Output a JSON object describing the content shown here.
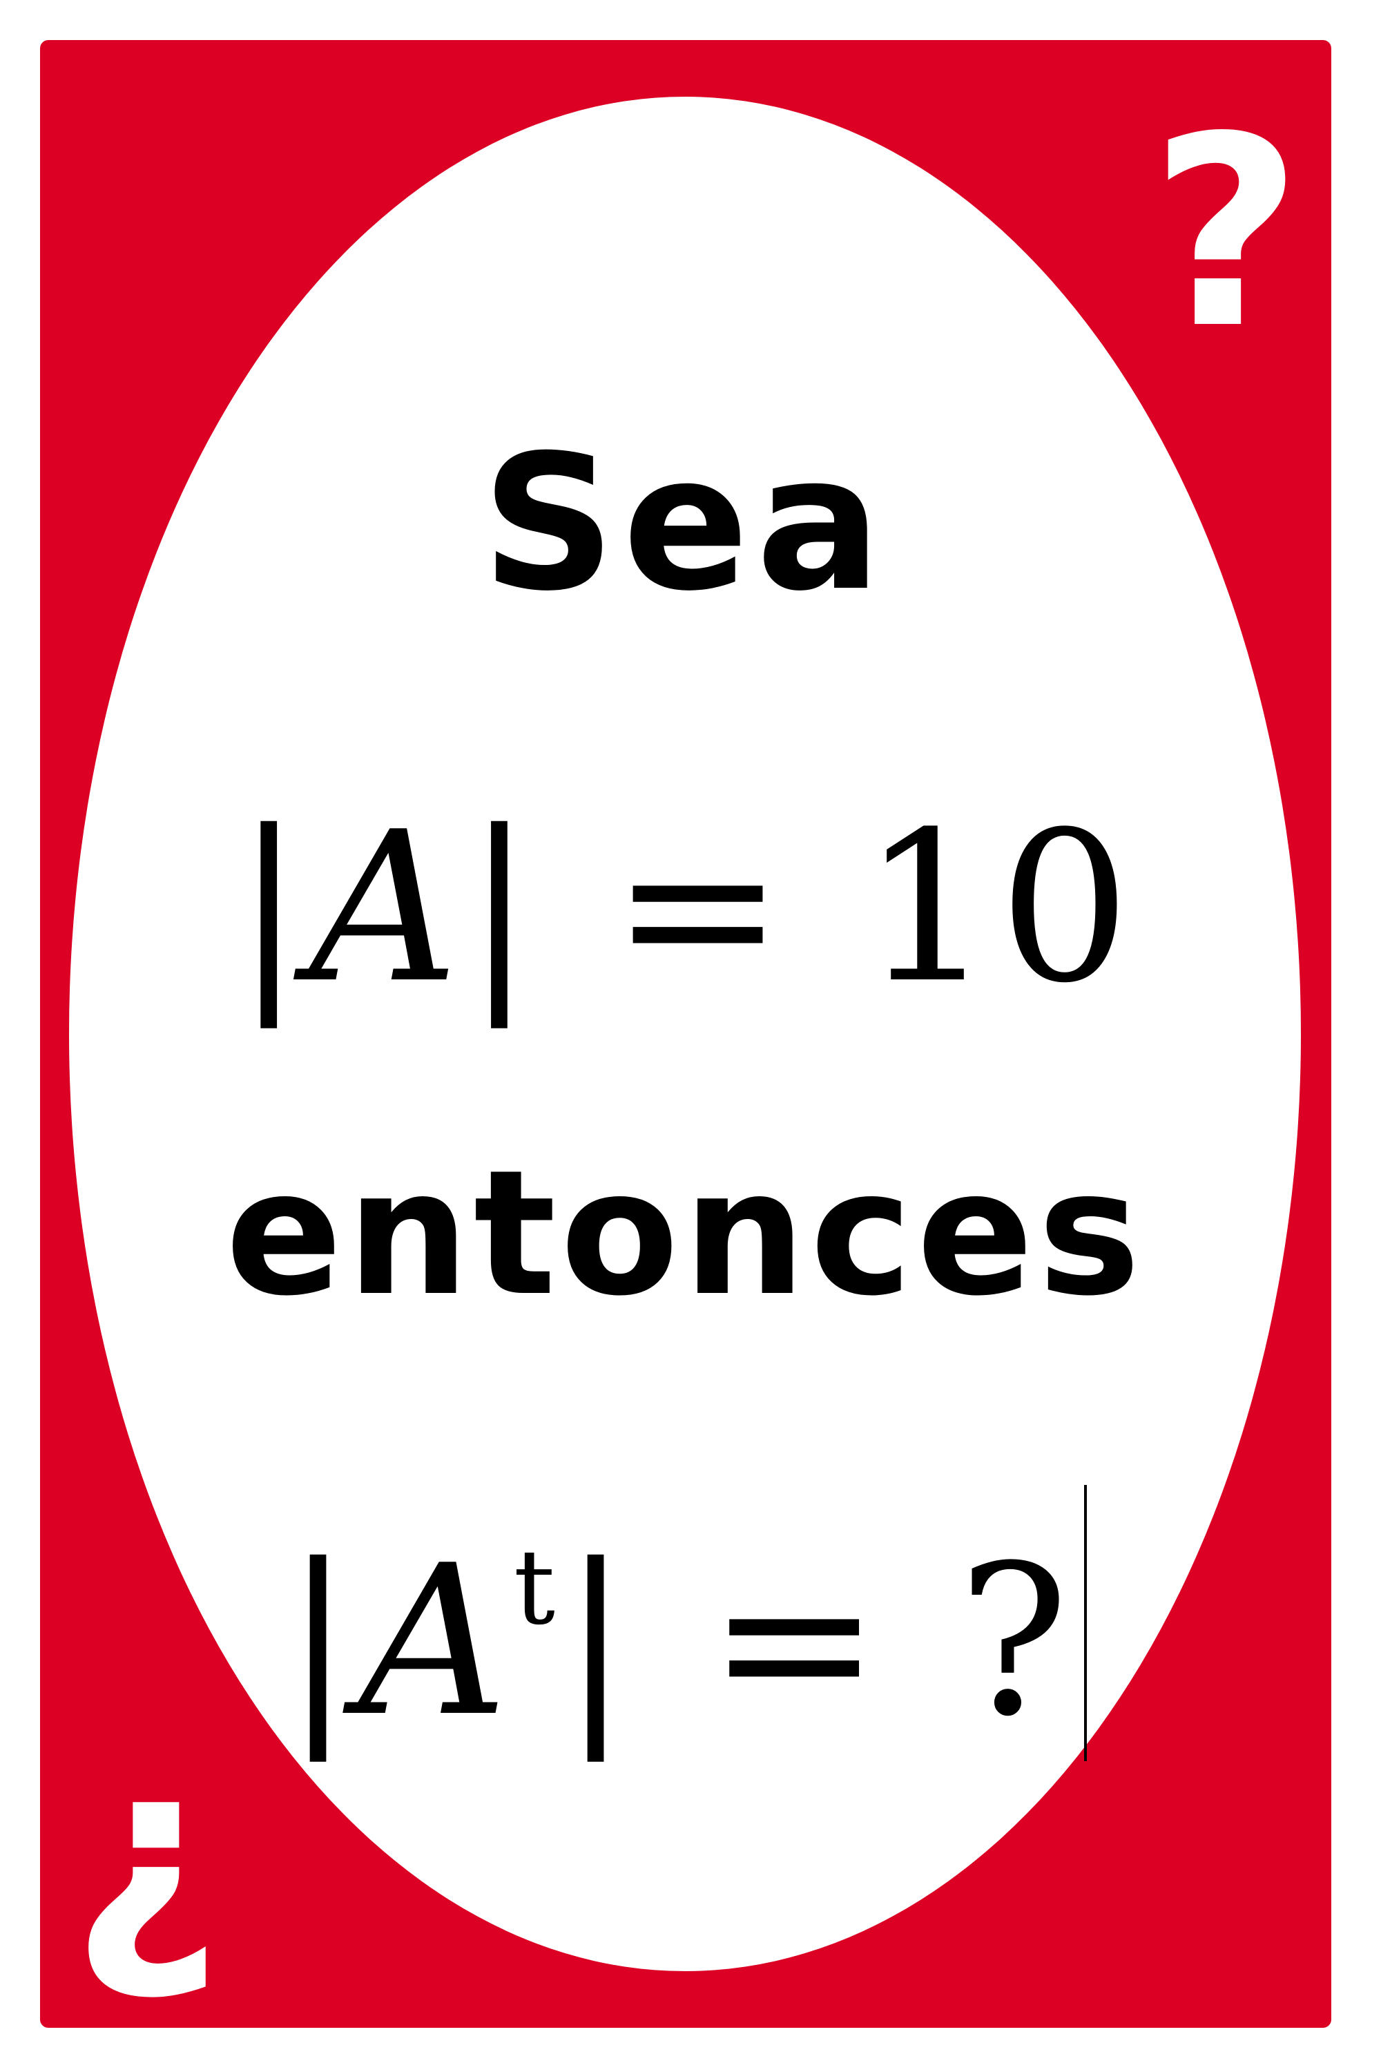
{
  "card": {
    "corner_top": "?",
    "corner_bottom": "¿",
    "word_1": "Sea",
    "math_1": {
      "bar_left": "|",
      "var": "A",
      "bar_right": "|",
      "rest": " = 10"
    },
    "word_2": "entonces",
    "math_2": {
      "bar_left": "|",
      "var": "A",
      "sup": "t",
      "bar_right": "|",
      "rest": " = ?"
    },
    "colors": {
      "card_red": "#dc0024",
      "oval_white": "#ffffff",
      "text": "#000000"
    }
  }
}
